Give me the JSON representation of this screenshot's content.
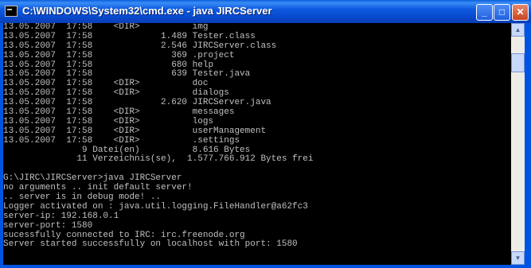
{
  "window": {
    "title": "C:\\WINDOWS\\System32\\cmd.exe - java JIRCServer",
    "buttons": {
      "minimize": "_",
      "maximize": "□",
      "close": "✕"
    }
  },
  "console": {
    "lines": [
      "13.05.2007  17:58    <DIR>          img",
      "13.05.2007  17:58             1.489 Tester.class",
      "13.05.2007  17:58             2.546 JIRCServer.class",
      "13.05.2007  17:58               369 .project",
      "13.05.2007  17:58               680 help",
      "13.05.2007  17:58               639 Tester.java",
      "13.05.2007  17:58    <DIR>          doc",
      "13.05.2007  17:58    <DIR>          dialogs",
      "13.05.2007  17:58             2.620 JIRCServer.java",
      "13.05.2007  17:58    <DIR>          messages",
      "13.05.2007  17:58    <DIR>          logs",
      "13.05.2007  17:58    <DIR>          userManagement",
      "13.05.2007  17:58    <DIR>          .settings",
      "               9 Datei(en)          8.616 Bytes",
      "              11 Verzeichnis(se),  1.577.766.912 Bytes frei",
      "",
      "G:\\JIRC\\JIRCServer>java JIRCServer",
      "no arguments .. init default server!",
      ".. server is in debug mode! ..",
      "Logger activated on : java.util.logging.FileHandler@a62fc3",
      "server-ip: 192.168.0.1",
      "server-port: 1580",
      "sucessfully connected to IRC: irc.freenode.org",
      "Server started successfully on localhost with port: 1580",
      ""
    ]
  },
  "scrollbar": {
    "up_arrow": "▲",
    "down_arrow": "▼"
  }
}
